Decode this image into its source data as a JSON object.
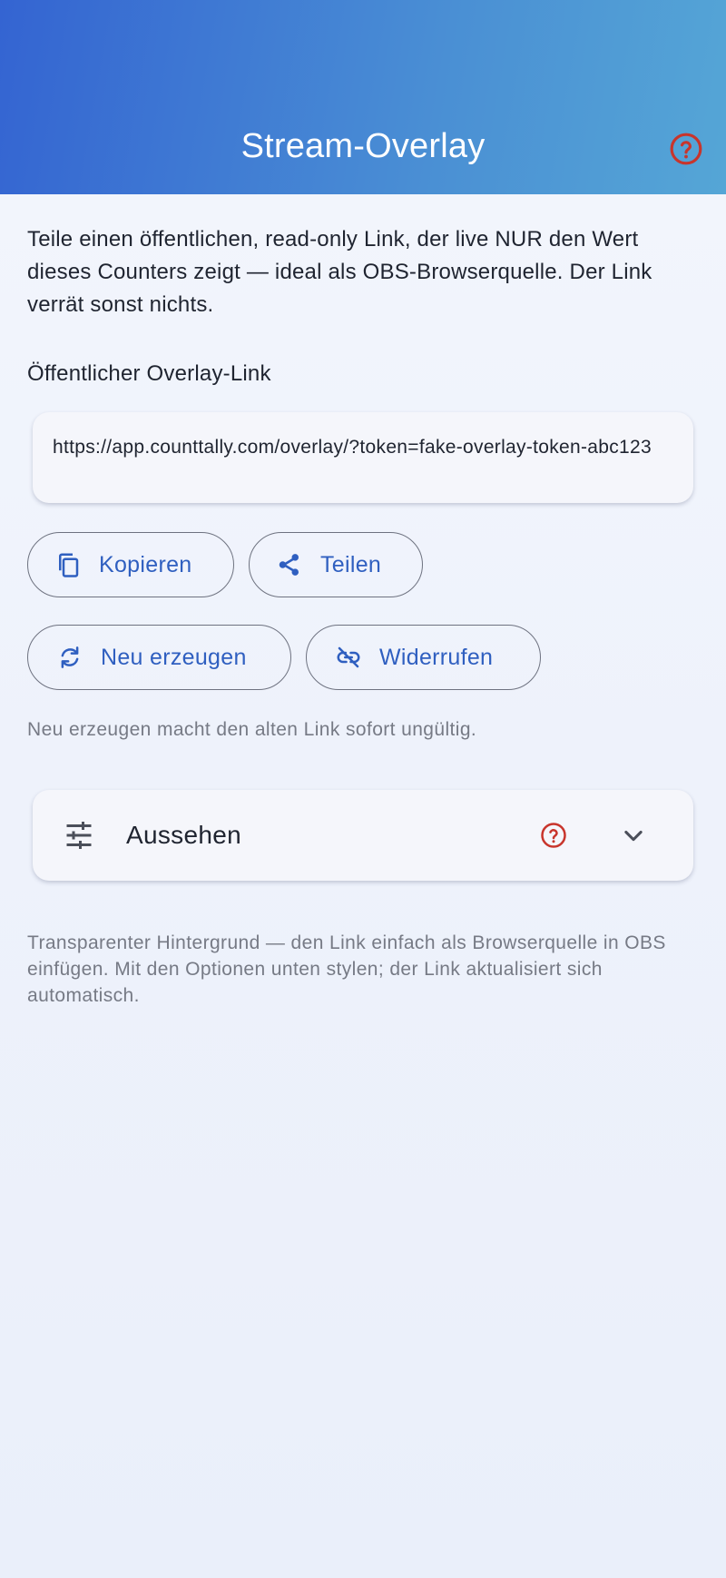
{
  "appbar": {
    "title": "Stream-Overlay",
    "help_icon": "help-circle-icon",
    "help_color": "#c8352c",
    "gradient": [
      "#3464d2",
      "#55a6d6"
    ]
  },
  "description": "Teile einen öffentlichen, read-only Link, der live NUR den Wert dieses Counters zeigt — ideal als OBS-Browserquelle. Der Link verrät sonst nichts.",
  "overlay_link": {
    "label": "Öffentlicher Overlay-Link",
    "url": "https://app.counttally.com/overlay/?token=fake-overlay-token-abc123"
  },
  "actions": {
    "copy": {
      "label": "Kopieren",
      "icon": "copy-icon"
    },
    "share": {
      "label": "Teilen",
      "icon": "share-icon"
    },
    "regenerate": {
      "label": "Neu erzeugen",
      "icon": "refresh-icon"
    },
    "revoke": {
      "label": "Widerrufen",
      "icon": "link-off-icon"
    },
    "accent": "#2f5fc0"
  },
  "regen_hint": "Neu erzeugen macht den alten Link sofort ungültig.",
  "appearance": {
    "title": "Aussehen",
    "icon": "tune-icon",
    "help_icon": "help-circle-icon",
    "chevron": "chevron-down-icon"
  },
  "footnote": "Transparenter Hintergrund — den Link einfach als Browserquelle in OBS einfügen. Mit den Optionen unten stylen; der Link aktualisiert sich automatisch."
}
